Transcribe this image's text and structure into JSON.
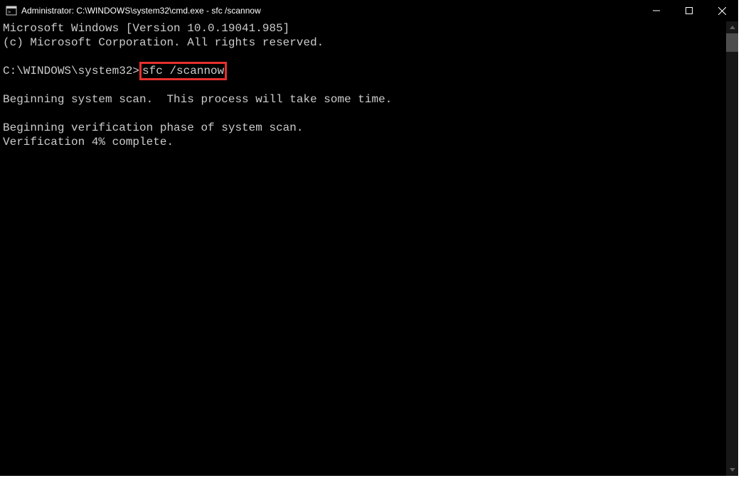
{
  "titlebar": {
    "title": "Administrator: C:\\WINDOWS\\system32\\cmd.exe - sfc  /scannow"
  },
  "terminal": {
    "line1": "Microsoft Windows [Version 10.0.19041.985]",
    "line2": "(c) Microsoft Corporation. All rights reserved.",
    "prompt": "C:\\WINDOWS\\system32>",
    "command": "sfc /scannow",
    "line_scan": "Beginning system scan.  This process will take some time.",
    "line_verif": "Beginning verification phase of system scan.",
    "line_progress": "Verification 4% complete."
  }
}
